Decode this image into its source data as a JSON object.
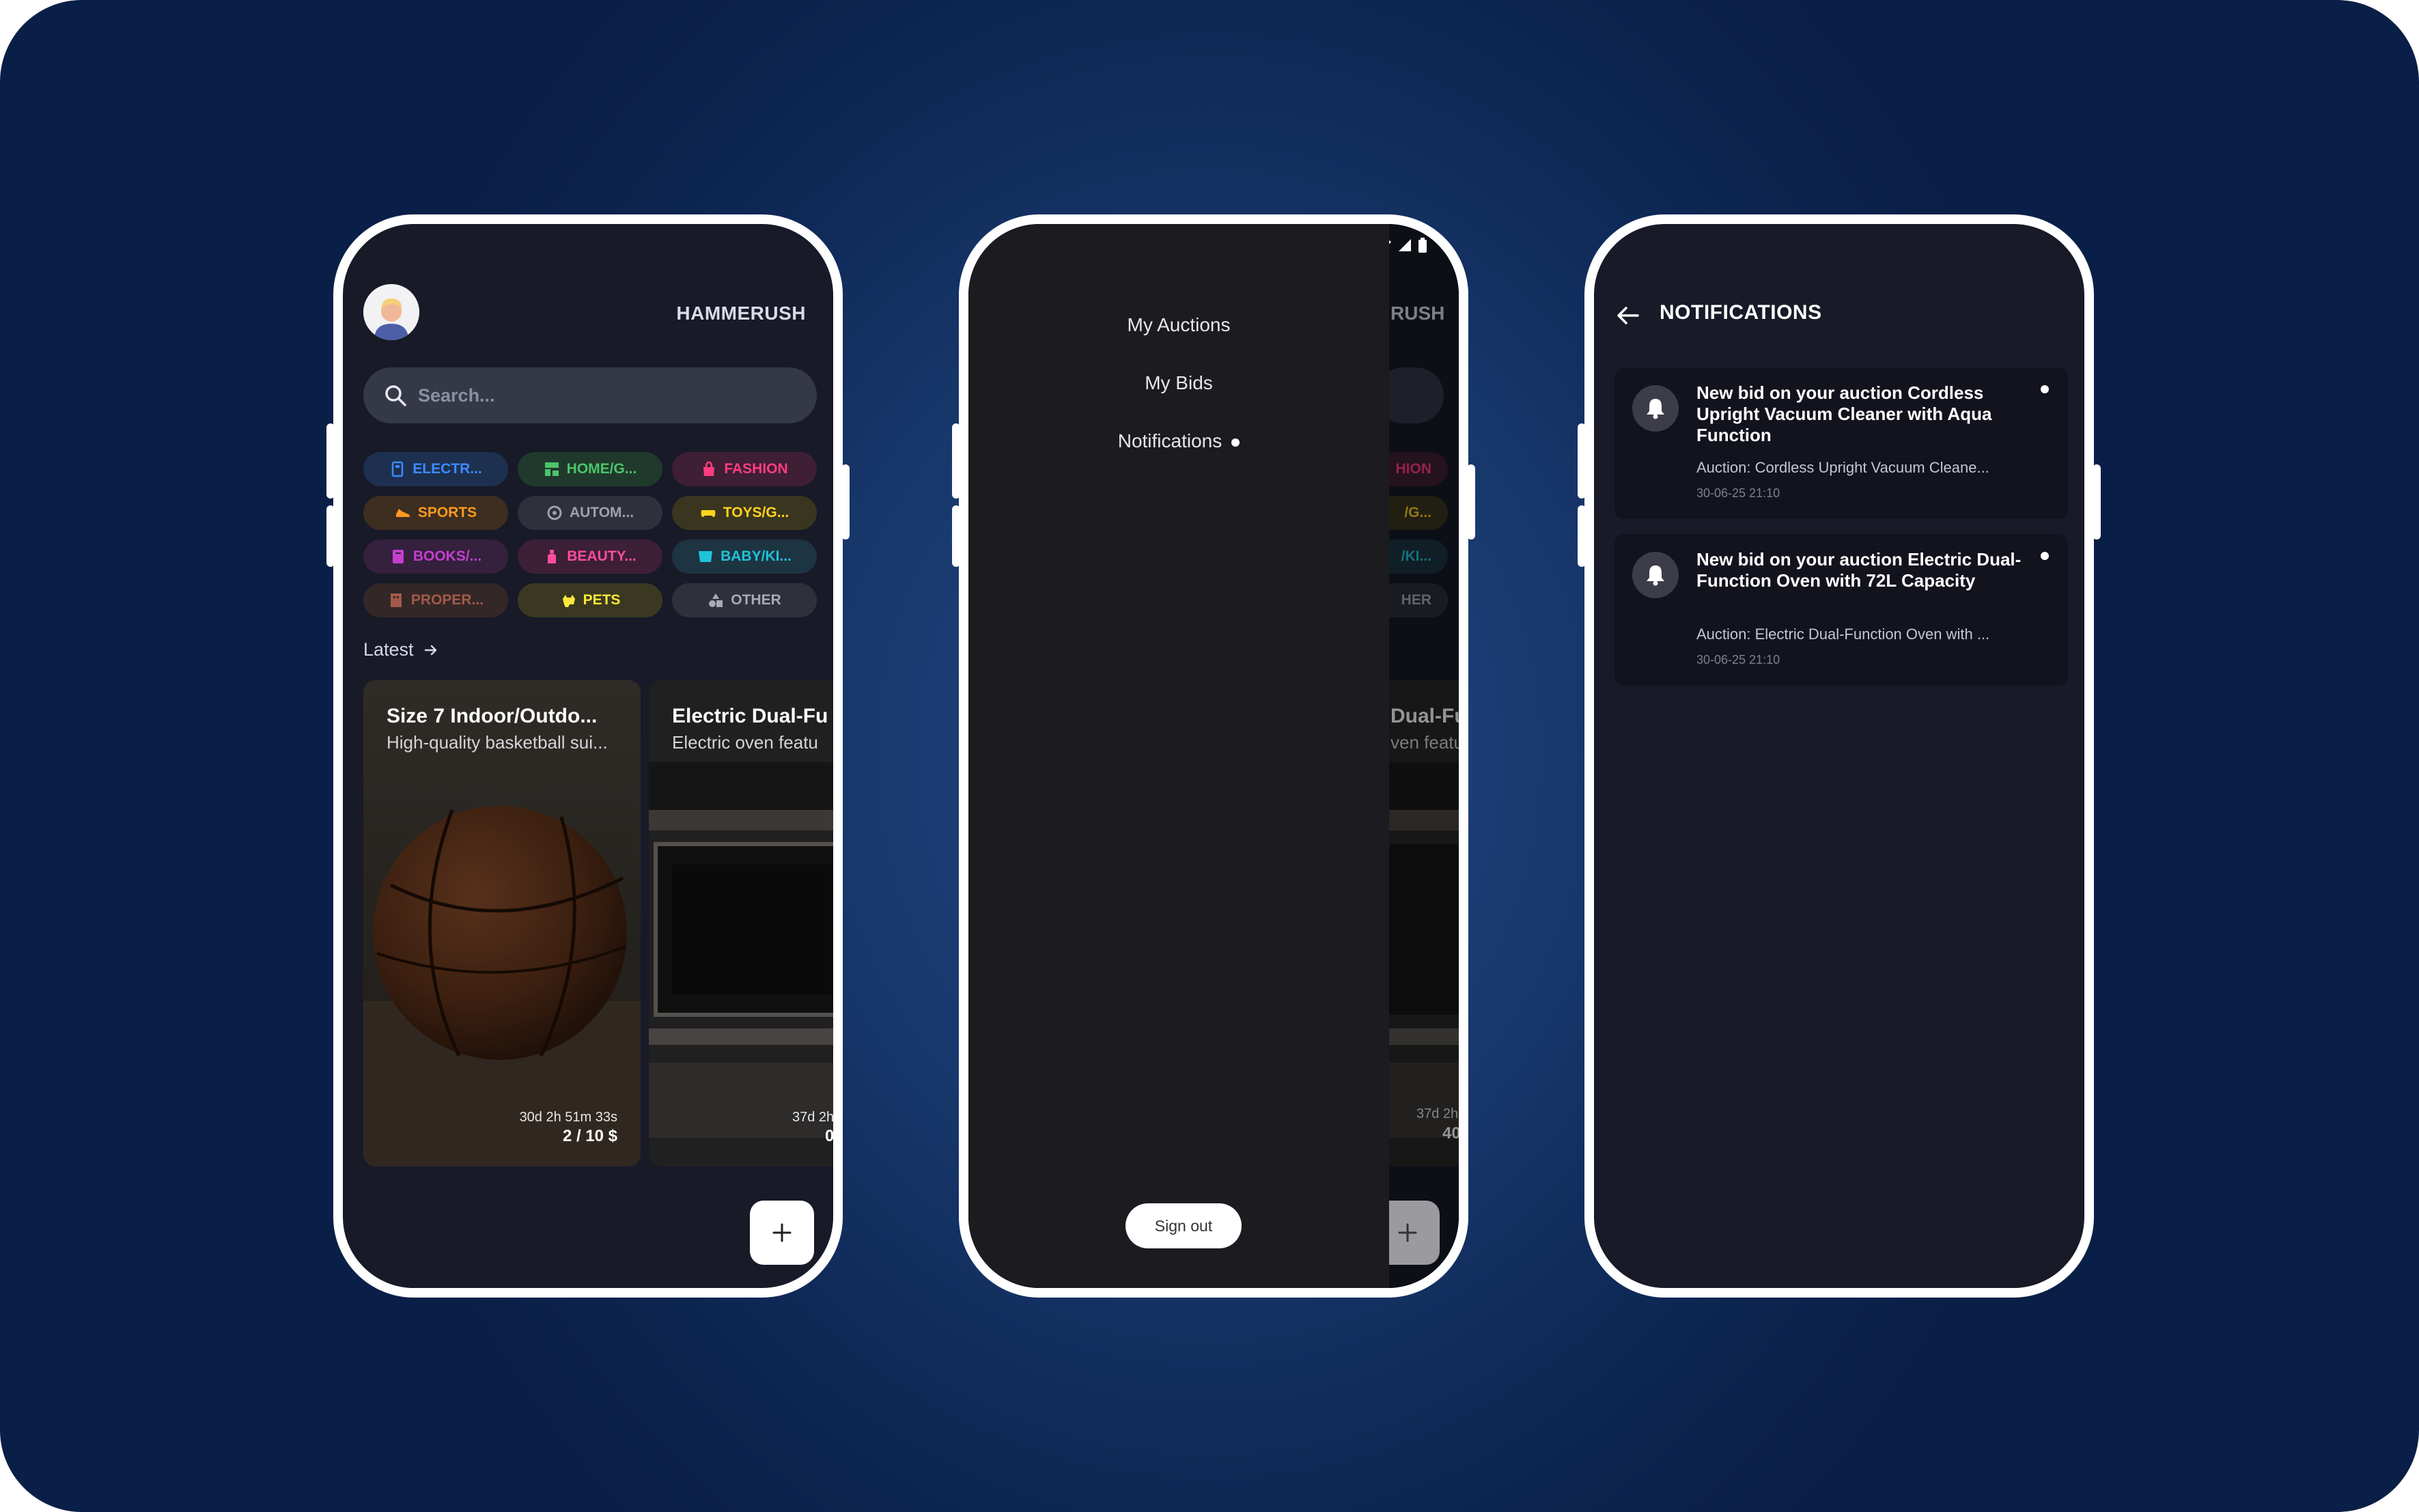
{
  "home": {
    "app_title": "HAMMERUSH",
    "search_placeholder": "Search...",
    "categories": [
      {
        "label": "ELECTR...",
        "icon": "electronics-icon",
        "color": "#3b8cff",
        "bg": "#1d3050"
      },
      {
        "label": "HOME/G...",
        "icon": "home-garden-icon",
        "color": "#4cc46a",
        "bg": "#1f3a2c"
      },
      {
        "label": "FASHION",
        "icon": "fashion-bag-icon",
        "color": "#ff3d7f",
        "bg": "#3e1f33"
      },
      {
        "label": "SPORTS",
        "icon": "sports-shoe-icon",
        "color": "#ff9a1f",
        "bg": "#3d2e1f"
      },
      {
        "label": "AUTOM...",
        "icon": "automotive-wheel-icon",
        "color": "#9ea2ae",
        "bg": "#2e303b"
      },
      {
        "label": "TOYS/G...",
        "icon": "gamepad-icon",
        "color": "#ffd21f",
        "bg": "#39351f"
      },
      {
        "label": "BOOKS/...",
        "icon": "book-icon",
        "color": "#c43fd0",
        "bg": "#35203d"
      },
      {
        "label": "BEAUTY...",
        "icon": "perfume-icon",
        "color": "#ff4da0",
        "bg": "#3d1f36"
      },
      {
        "label": "BABY/KI...",
        "icon": "baby-icon",
        "color": "#1fc4d8",
        "bg": "#1d3442"
      },
      {
        "label": "PROPER...",
        "icon": "property-icon",
        "color": "#a35a4a",
        "bg": "#332727"
      },
      {
        "label": "PETS",
        "icon": "pet-icon",
        "color": "#ffe83a",
        "bg": "#3a3820"
      },
      {
        "label": "OTHER",
        "icon": "shapes-icon",
        "color": "#a8abb6",
        "bg": "#2e303b"
      }
    ],
    "latest_label": "Latest",
    "cards": [
      {
        "title": "Size 7 Indoor/Outdo...",
        "description": "High-quality basketball sui...",
        "time_left": "30d 2h 51m 33s",
        "price": "2 / 10 $"
      },
      {
        "title": "Electric Dual-Fu",
        "description": "Electric oven featu",
        "time_left": "37d 2h",
        "price": "0"
      }
    ]
  },
  "drawer": {
    "items": [
      "My Auctions",
      "My Bids",
      "Notifications"
    ],
    "sign_out": "Sign out",
    "peek": {
      "title_fragment": "RUSH",
      "chips": [
        "HION",
        "/G...",
        "/KI...",
        "HER"
      ],
      "card_title": "Dual-Fu",
      "card_desc": "ven featu",
      "card_time": "37d 2h",
      "card_price": "40"
    }
  },
  "notifications": {
    "title": "NOTIFICATIONS",
    "items": [
      {
        "title": "New bid on your auction Cordless Upright Vacuum Cleaner with Aqua Function",
        "subtitle": "Auction: Cordless Upright Vacuum Cleane...",
        "time": "30-06-25 21:10"
      },
      {
        "title": "New bid on your auction Electric Dual-Function Oven with 72L Capacity",
        "subtitle": "Auction: Electric Dual-Function Oven with ...",
        "time": "30-06-25 21:10"
      }
    ]
  }
}
